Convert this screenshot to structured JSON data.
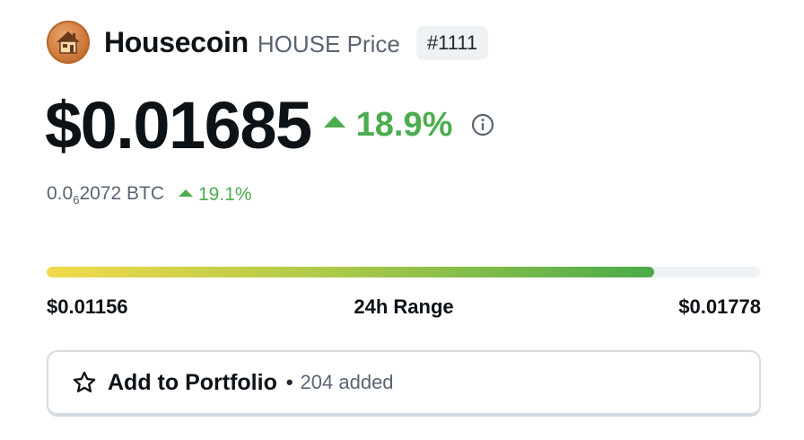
{
  "header": {
    "coin_name": "Housecoin",
    "subtitle": "HOUSE Price",
    "rank": "#1111",
    "logo_icon": "house-logo-icon"
  },
  "price": {
    "usd": "$0.01685",
    "change_24h": "18.9%",
    "direction": "up",
    "up_color": "#4bad4f",
    "info_icon": "info-icon"
  },
  "btc": {
    "prefix": "0.0",
    "zero_count_subscript": "6",
    "digits": "2072 BTC",
    "change": "19.1%",
    "direction": "up"
  },
  "range": {
    "low": "$0.01156",
    "label": "24h Range",
    "high": "$0.01778",
    "fill_percent": 85,
    "gradient_colors": [
      "#f2da4b",
      "#a8c84a",
      "#4bab4a"
    ]
  },
  "portfolio": {
    "label": "Add to Portfolio",
    "separator": "•",
    "added_text": "204 added",
    "icon": "star-outline-icon"
  }
}
